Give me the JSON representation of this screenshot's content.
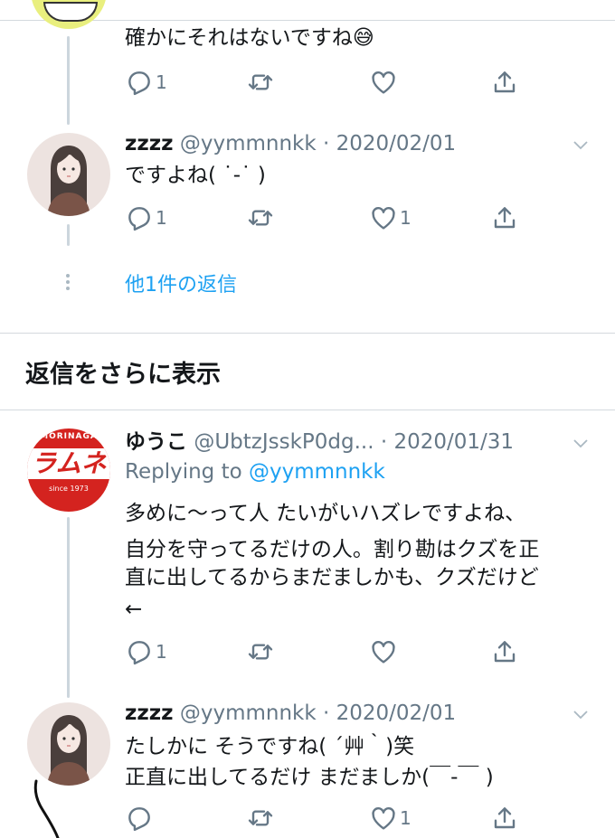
{
  "tweets": [
    {
      "text": "確かにそれはないですね😅",
      "reply_count": "1",
      "retweet_count": "",
      "like_count": ""
    },
    {
      "name": "zzzz",
      "handle": "@yymmnnkk",
      "date": "· 2020/02/01",
      "text": "ですよね( ˙-˙ )",
      "reply_count": "1",
      "retweet_count": "",
      "like_count": "1"
    },
    {
      "name": "ゆうこ",
      "handle": "@UbtzJsskP0dg...",
      "date": "· 2020/01/31",
      "replying_prefix": "Replying to ",
      "replying_handle": "@yymmnnkk",
      "text_lines": [
        "多めに〜って人 たいがいハズレですよね、",
        "自分を守ってるだけの人。割り勘はクズを正",
        "直に出してるからまだましかも、クズだけど",
        "←"
      ],
      "reply_count": "1",
      "retweet_count": "",
      "like_count": ""
    },
    {
      "name": "zzzz",
      "handle": "@yymmnnkk",
      "date": "· 2020/02/01",
      "text_lines": [
        "たしかに そうですね( ´艸｀)笑",
        "正直に出してるだけ まだましか(￣-￣ )"
      ],
      "reply_count": "",
      "retweet_count": "",
      "like_count": "1"
    }
  ],
  "more_replies_label": "他1件の返信",
  "section_title": "返信をさらに表示",
  "avatar1_text": {
    "line1": "MORINAGA",
    "line2": "ラムネ",
    "line3": "since 1973"
  },
  "colors": {
    "accent": "#1da1f2",
    "secondary_text": "#657786",
    "divider": "#d4d9de",
    "brand_red": "#d4231f"
  }
}
